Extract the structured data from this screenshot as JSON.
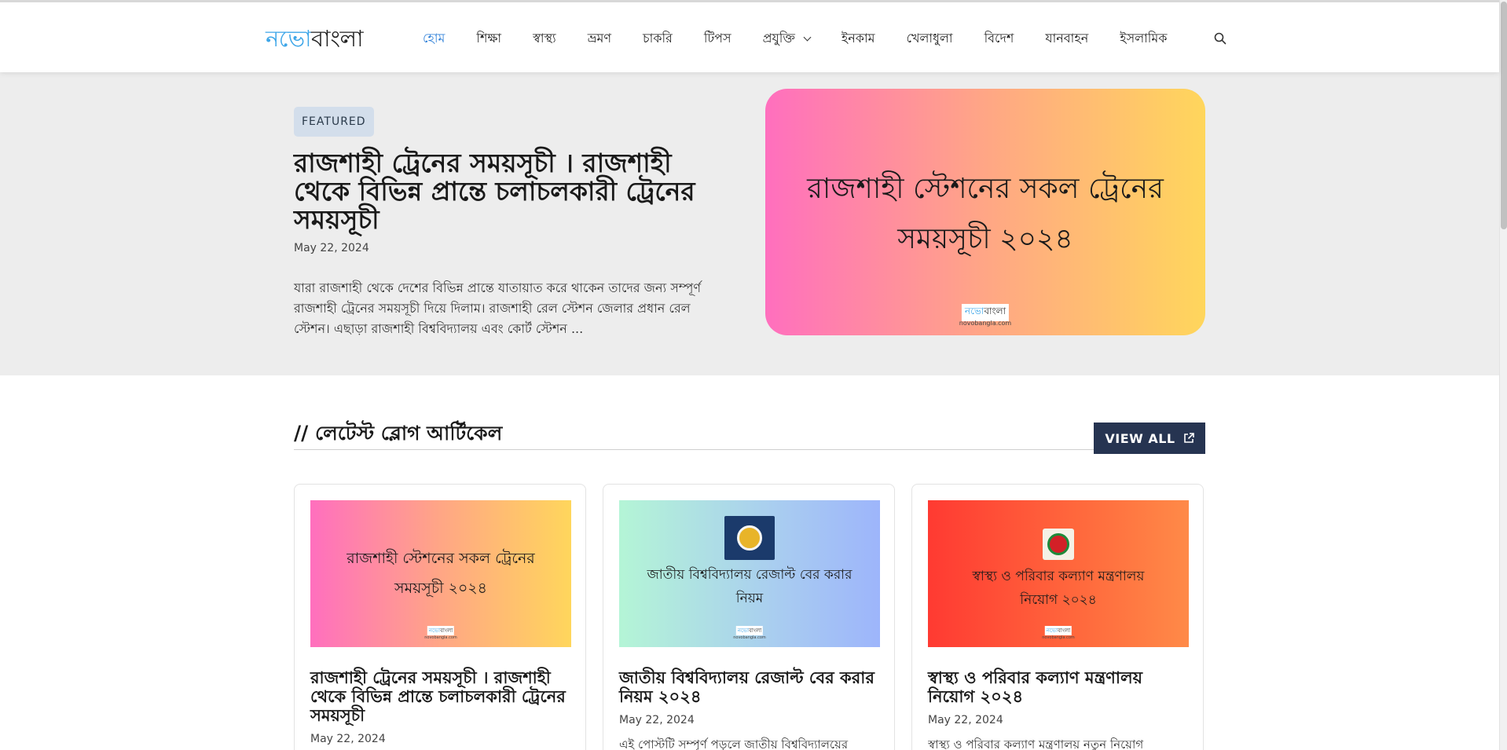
{
  "logo": {
    "part1": "নভো",
    "part2": "বাংলা"
  },
  "nav": {
    "items": [
      {
        "label": "হোম",
        "active": true
      },
      {
        "label": "শিক্ষা"
      },
      {
        "label": "স্বাস্থ্য"
      },
      {
        "label": "ভ্রমণ"
      },
      {
        "label": "চাকরি"
      },
      {
        "label": "টিপস"
      },
      {
        "label": "প্রযুক্তি",
        "has_dropdown": true
      },
      {
        "label": "ইনকাম"
      },
      {
        "label": "খেলাধুলা"
      },
      {
        "label": "বিদেশ"
      },
      {
        "label": "যানবাহন"
      },
      {
        "label": "ইসলামিক"
      }
    ],
    "search_icon": "search-icon"
  },
  "featured": {
    "badge": "FEATURED",
    "title": "রাজশাহী ট্রেনের সময়সূচী । রাজশাহী থেকে বিভিন্ন প্রান্তে চলাচলকারী ট্রেনের সময়সূচী",
    "date": "May 22, 2024",
    "excerpt": "যারা রাজশাহী থেকে দেশের বিভিন্ন প্রান্তে যাতায়াত করে থাকেন তাদের জন্য সম্পূর্ণ রাজশাহী ট্রেনের সময়সূচী দিয়ে দিলাম। রাজশাহী রেল স্টেশন জেলার প্রধান রেল স্টেশন। এছাড়া রাজশাহী বিশ্ববিদ্যালয় এবং কোর্ট স্টেশন ...",
    "image_text_line1": "রাজশাহী স্টেশনের সকল ট্রেনের",
    "image_text_line2": "সময়সূচী ২০২৪",
    "image_logo_part1": "নভো",
    "image_logo_part2": "বাংলা",
    "image_url": "novobangla.com"
  },
  "latest": {
    "title": "// লেটেস্ট ব্লোগ আর্টিকেল",
    "view_all": "VIEW ALL",
    "cards": [
      {
        "image_text_line1": "রাজশাহী স্টেশনের সকল ট্রেনের",
        "image_text_line2": "সময়সূচী ২০২৪",
        "title": "রাজশাহী ট্রেনের সময়সূচী । রাজশাহী থেকে বিভিন্ন প্রান্তে চলাচলকারী ট্রেনের সময়সূচী",
        "date": "May 22, 2024",
        "excerpt": ""
      },
      {
        "image_text_line1": "জাতীয় বিশ্ববিদ্যালয় রেজাল্ট বের করার",
        "image_text_line2": "নিয়ম",
        "title": "জাতীয় বিশ্ববিদ্যালয় রেজাল্ট বের করার নিয়ম ২০২৪",
        "date": "May 22, 2024",
        "excerpt": "এই পোস্টটি সম্পূর্ণ পড়লে জাতীয় বিশ্ববিদ্যালয়ের"
      },
      {
        "image_text_line1": "স্বাস্থ্য ও পরিবার কল্যাণ মন্ত্রণালয়",
        "image_text_line2": "নিয়োগ ২০২৪",
        "title": "স্বাস্থ্য ও পরিবার কল্যাণ মন্ত্রণালয় নিয়োগ ২০২৪",
        "date": "May 22, 2024",
        "excerpt": "স্বাস্থ্য ও পরিবার কল্যাণ মন্ত্রণালয় নতুন নিয়োগ"
      }
    ]
  },
  "colors": {
    "accent": "#2d7fd8",
    "logo_blue": "#3ea6e8",
    "view_all_bg": "#263451",
    "badge_bg": "#d3deeb",
    "featured_bg": "#ededed"
  }
}
